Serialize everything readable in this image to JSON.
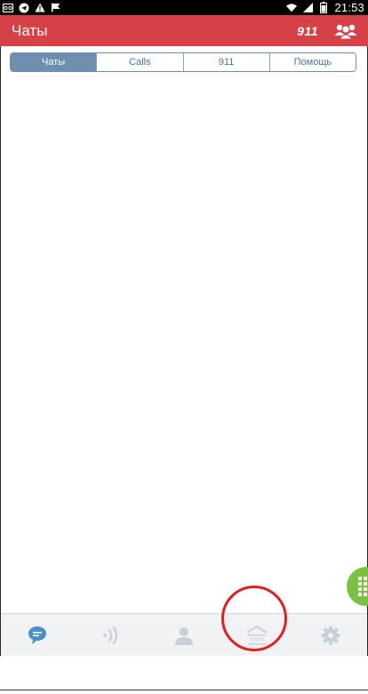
{
  "status_bar": {
    "time": "21:53",
    "left_icons": [
      "voicemail-icon",
      "telegram-icon",
      "warning-icon",
      "flag-icon"
    ],
    "right_icons": [
      "wifi-icon",
      "signal-icon",
      "battery-icon"
    ]
  },
  "app_bar": {
    "title": "Чаты",
    "emergency_label": "911",
    "contacts_icon": "contacts-group-icon",
    "color": "#d54146"
  },
  "tabs": [
    {
      "label": "Чаты",
      "active": true
    },
    {
      "label": "Calls",
      "active": false
    },
    {
      "label": "911",
      "active": false
    },
    {
      "label": "Помощь",
      "active": false
    }
  ],
  "tab_accent": "#6f8fb0",
  "fab": {
    "icon": "dialpad-icon",
    "color": "#7cc142"
  },
  "bottom_nav": {
    "items": [
      {
        "icon": "chat-bubble-icon",
        "active": true
      },
      {
        "icon": "broadcast-icon",
        "active": false
      },
      {
        "icon": "person-icon",
        "active": false
      },
      {
        "icon": "bank-icon",
        "label": "BANK",
        "active": false
      },
      {
        "icon": "settings-gear-icon",
        "active": false
      }
    ],
    "active_color": "#4a90c8",
    "inactive_color": "#c8cfd7"
  },
  "annotation": {
    "shape": "circle",
    "color": "#e02020",
    "target": "bank-icon"
  }
}
